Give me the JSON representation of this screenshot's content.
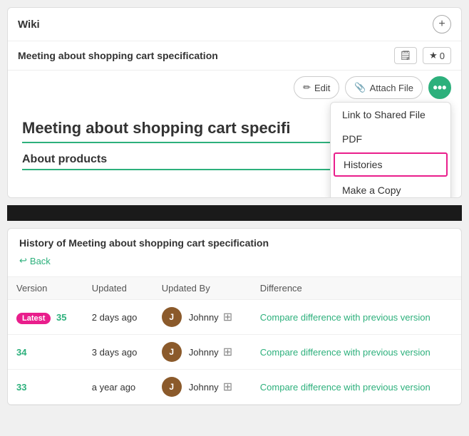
{
  "app": {
    "title": "Wiki"
  },
  "doc_header": {
    "title": "Meeting about shopping cart specification",
    "star_count": "0",
    "edit_label": "Edit",
    "attach_label": "Attach File"
  },
  "dropdown": {
    "items": [
      {
        "id": "link-shared",
        "label": "Link to Shared File",
        "highlighted": false
      },
      {
        "id": "pdf",
        "label": "PDF",
        "highlighted": false
      },
      {
        "id": "histories",
        "label": "Histories",
        "highlighted": true
      },
      {
        "id": "make-copy",
        "label": "Make a Copy",
        "highlighted": false
      }
    ]
  },
  "wiki_content": {
    "title": "Meeting about shopping cart specifi",
    "subtitle": "About products"
  },
  "history": {
    "title": "History of Meeting about shopping cart specification",
    "back_label": "Back",
    "columns": [
      "Version",
      "Updated",
      "Updated By",
      "Difference"
    ],
    "rows": [
      {
        "is_latest": true,
        "version": "35",
        "updated": "2 days ago",
        "updated_by": "Johnny",
        "compare_label": "Compare difference with previous version"
      },
      {
        "is_latest": false,
        "version": "34",
        "updated": "3 days ago",
        "updated_by": "Johnny",
        "compare_label": "Compare difference with previous version"
      },
      {
        "is_latest": false,
        "version": "33",
        "updated": "a year ago",
        "updated_by": "Johnny",
        "compare_label": "Compare difference with previous version"
      }
    ]
  },
  "colors": {
    "accent": "#2db07c",
    "pink": "#e91e8c",
    "more_btn": "#2db07c"
  },
  "labels": {
    "latest": "Latest",
    "back_arrow": "↩",
    "more_dots": "•••",
    "pencil": "✏",
    "paperclip": "📎",
    "star": "★"
  }
}
